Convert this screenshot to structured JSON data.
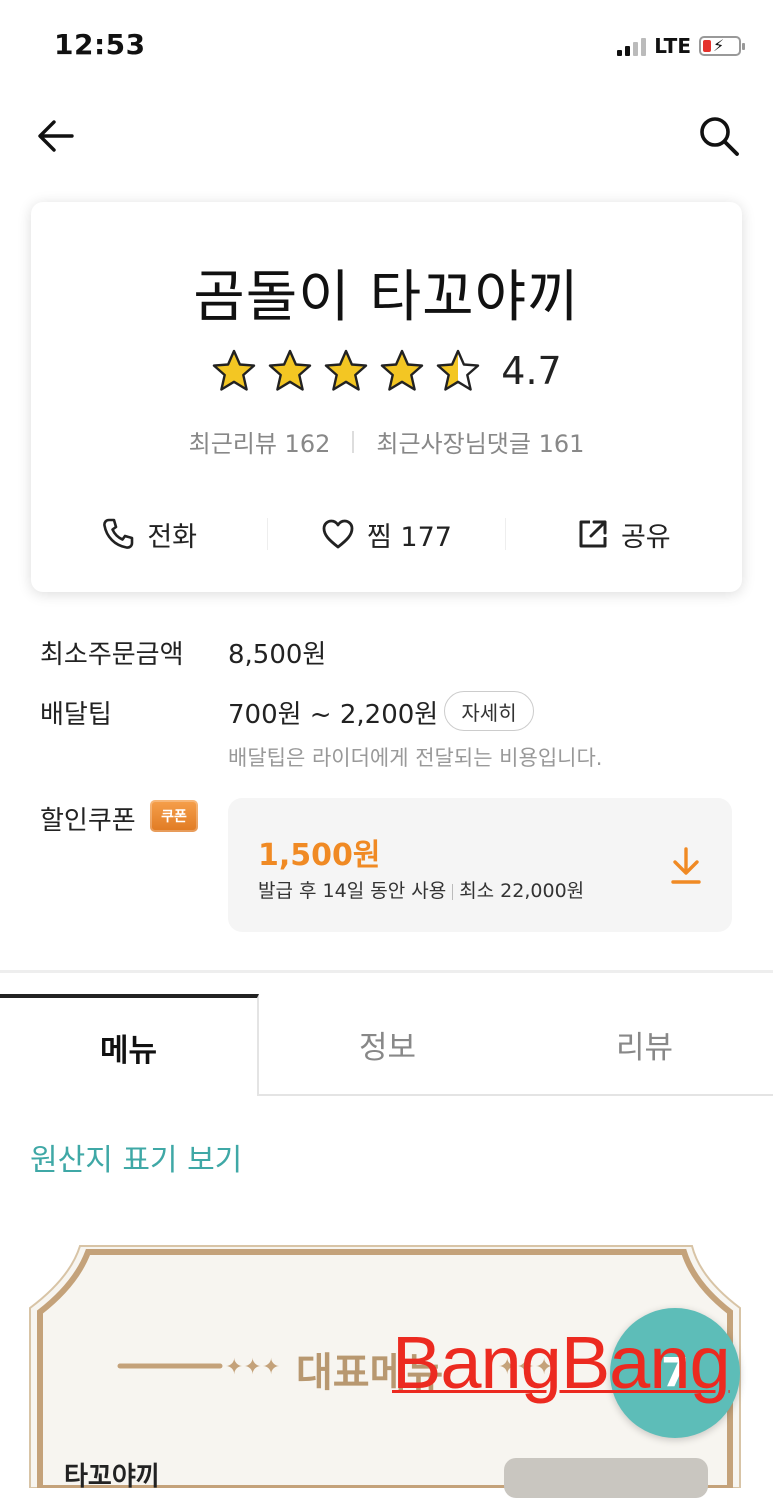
{
  "status_bar": {
    "time": "12:53",
    "network": "LTE"
  },
  "store": {
    "name": "곰돌이 타꼬야끼",
    "rating": "4.7",
    "rating_value": 4.7,
    "recent_reviews": "최근리뷰 162",
    "owner_replies": "최근사장님댓글 161",
    "actions": {
      "call": "전화",
      "favorite": "찜 177",
      "share": "공유"
    }
  },
  "info": {
    "min_order_label": "최소주문금액",
    "min_order_value": "8,500원",
    "delivery_tip_label": "배달팁",
    "delivery_tip_value": "700원 ~ 2,200원",
    "detail_button": "자세히",
    "delivery_tip_note": "배달팁은 라이더에게 전달되는 비용입니다.",
    "coupon_label": "할인쿠폰",
    "coupon_badge": "쿠폰",
    "coupon_amount": "1,500원",
    "coupon_validity": "발급 후 14일 동안 사용",
    "coupon_minimum": "최소 22,000원"
  },
  "tabs": [
    {
      "label": "메뉴",
      "active": true
    },
    {
      "label": "정보",
      "active": false
    },
    {
      "label": "리뷰",
      "active": false
    }
  ],
  "origin_link": "원산지 표기 보기",
  "banner": {
    "title": "대표메뉴",
    "fab_label": "7",
    "menu_item_peek": "타꼬야끼"
  },
  "watermark": "BangBang",
  "colors": {
    "accent_orange": "#f08a24",
    "teal": "#3fa8a6",
    "fab": "#5dbdb8",
    "star": "#f3c623",
    "watermark": "#ec2a20"
  }
}
